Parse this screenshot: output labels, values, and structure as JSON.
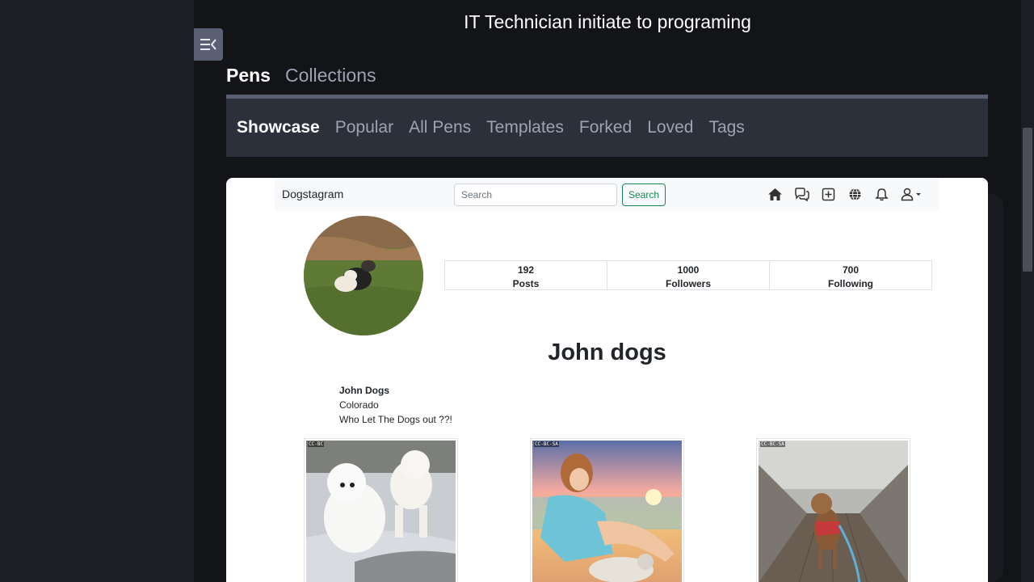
{
  "page": {
    "profile_title": "IT Technician initiate to programing"
  },
  "pen_tabs": [
    {
      "label": "Pens",
      "active": true
    },
    {
      "label": "Collections",
      "active": false
    }
  ],
  "sub_tabs": [
    {
      "label": "Showcase",
      "active": true
    },
    {
      "label": "Popular",
      "active": false
    },
    {
      "label": "All Pens",
      "active": false
    },
    {
      "label": "Templates",
      "active": false
    },
    {
      "label": "Forked",
      "active": false
    },
    {
      "label": "Loved",
      "active": false
    },
    {
      "label": "Tags",
      "active": false
    }
  ],
  "preview": {
    "navbar": {
      "brand": "Dogstagram",
      "search_placeholder": "Search",
      "search_button": "Search",
      "icons": [
        "home-icon",
        "chat-icon",
        "add-post-icon",
        "globe-icon",
        "bell-icon",
        "user-dropdown-icon"
      ]
    },
    "stats": [
      {
        "value": "192",
        "label": "Posts"
      },
      {
        "value": "1000",
        "label": "Followers"
      },
      {
        "value": "700",
        "label": "Following"
      }
    ],
    "display_name": "John dogs",
    "bio": {
      "name": "John Dogs",
      "location": "Colorado",
      "tagline": "Who Let The Dogs out ??!"
    },
    "posts": [
      {
        "badge": "CC-BC",
        "subject": "two white samoyed dogs in snow"
      },
      {
        "badge": "CC-BC-SA",
        "subject": "illustrated woman at sunset with dog"
      },
      {
        "badge": "CC-BC-SA",
        "subject": "brown dog on wooden bridge"
      }
    ]
  },
  "colors": {
    "app_bg": "#131417",
    "sidebar_bg": "#1e1f26",
    "subnav_bg": "#2c303a",
    "accent_green": "#198754"
  }
}
